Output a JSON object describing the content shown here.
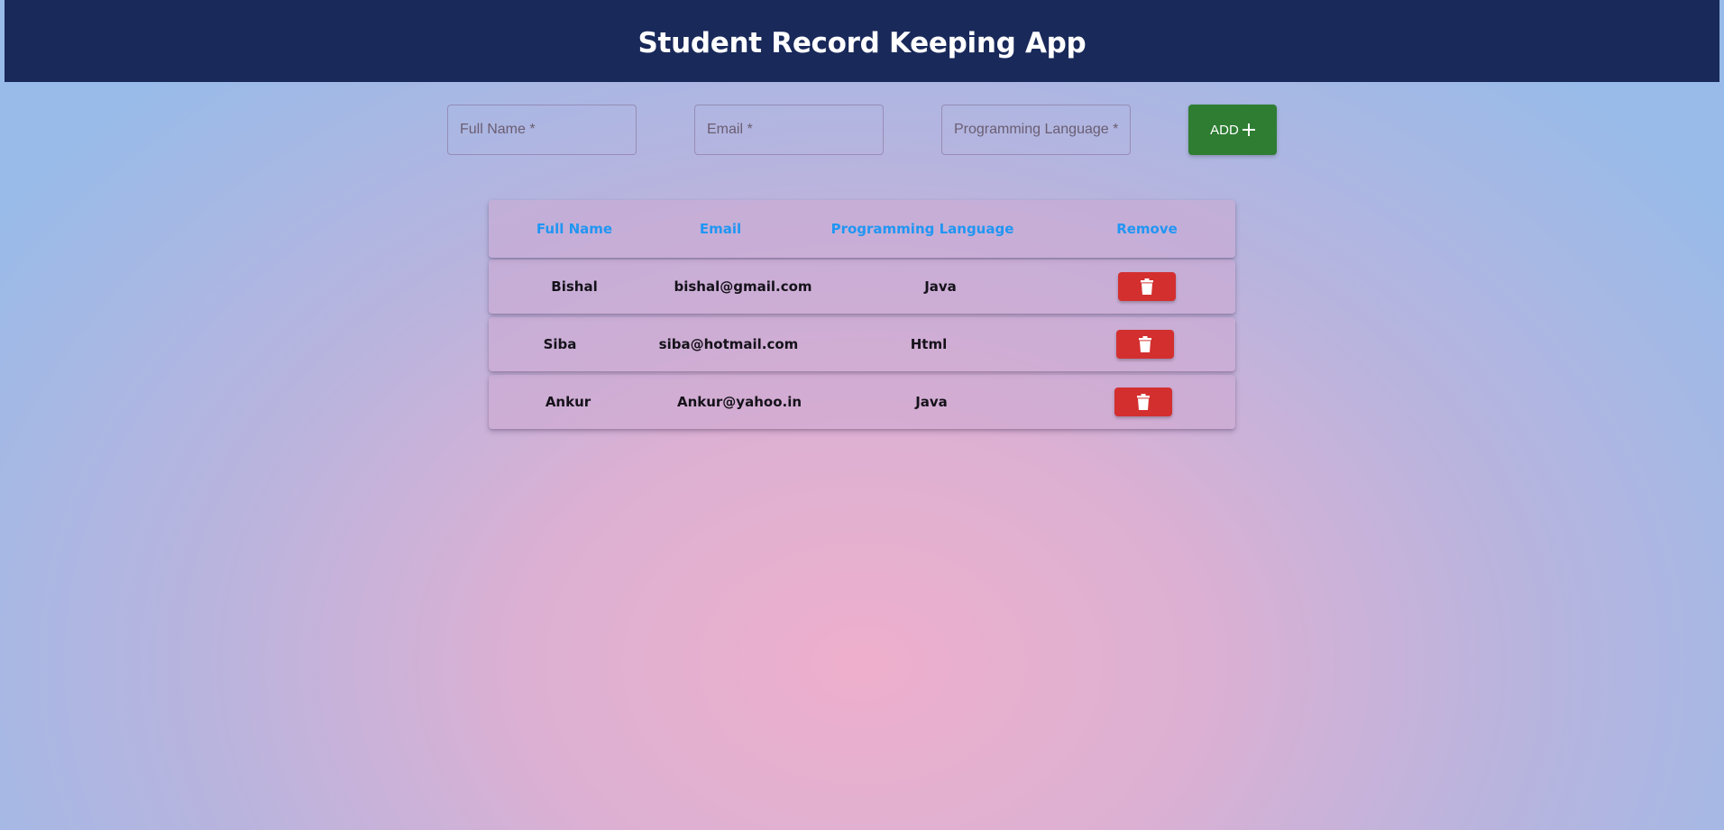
{
  "header": {
    "title": "Student Record Keeping App"
  },
  "form": {
    "full_name_placeholder": "Full Name *",
    "email_placeholder": "Email *",
    "language_placeholder": "Programming Language *",
    "add_label": "ADD",
    "add_icon": "plus-icon"
  },
  "table": {
    "headers": [
      "Full Name",
      "Email",
      "Programming Language",
      "Remove"
    ],
    "rows": [
      {
        "name": "Bishal",
        "email": "bishal@gmail.com",
        "language": "Java",
        "remove_icon": "trash-icon"
      },
      {
        "name": "Siba",
        "email": "siba@hotmail.com",
        "language": "Html",
        "remove_icon": "trash-icon"
      },
      {
        "name": "Ankur",
        "email": "Ankur@yahoo.in",
        "language": "Java",
        "remove_icon": "trash-icon"
      }
    ]
  },
  "colors": {
    "header_bg": "#19295a",
    "add_button": "#2e7d32",
    "delete_button": "#d32f2f",
    "table_header_text": "#2196f3"
  }
}
